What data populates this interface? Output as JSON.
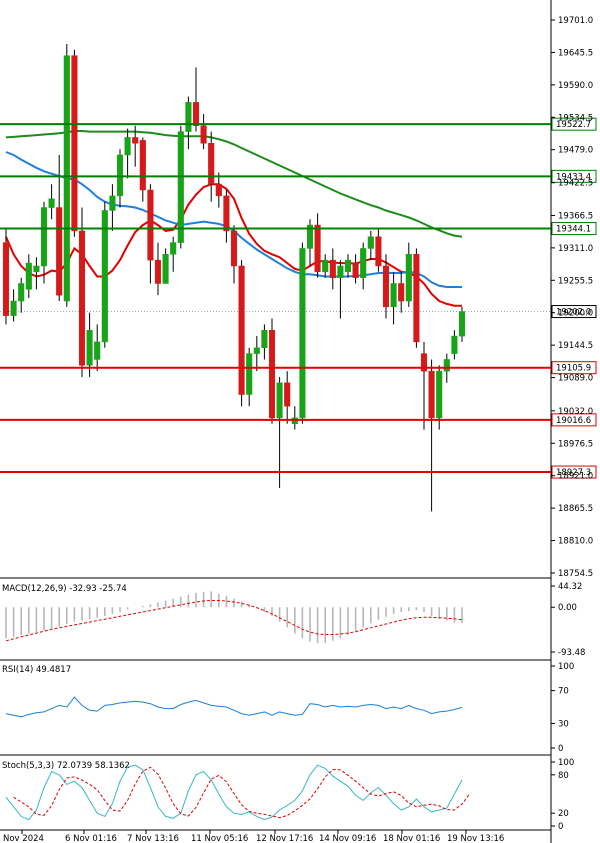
{
  "chart_data": [
    {
      "type": "candlestick",
      "panel": "price",
      "y_ticks": [
        "19701.0",
        "19645.5",
        "19590.0",
        "19534.5",
        "19479.0",
        "19422.5",
        "19366.5",
        "19311.0",
        "19255.5",
        "19200.0",
        "19144.5",
        "19089.0",
        "19032.0",
        "18976.5",
        "18921.0",
        "18865.5",
        "18810.0",
        "18754.5"
      ],
      "y_tick_values": [
        19701.0,
        19645.5,
        19590.0,
        19534.5,
        19479.0,
        19422.5,
        19366.5,
        19311.0,
        19255.5,
        19200.0,
        19144.5,
        19089.0,
        19032.0,
        18976.5,
        18921.0,
        18865.5,
        18810.0,
        18754.5
      ],
      "ylim": [
        18754.5,
        19701.0
      ],
      "current_price": "19202.0",
      "levels": [
        {
          "label": "19522.7",
          "value": 19522.7,
          "color": "#008000"
        },
        {
          "label": "19433.4",
          "value": 19433.4,
          "color": "#008000"
        },
        {
          "label": "19344.1",
          "value": 19344.1,
          "color": "#008000"
        },
        {
          "label": "19105.9",
          "value": 19105.9,
          "color": "#e00000"
        },
        {
          "label": "19016.6",
          "value": 19016.6,
          "color": "#e00000"
        },
        {
          "label": "18927.3",
          "value": 18927.3,
          "color": "#e00000"
        }
      ],
      "x_labels": [
        "Nov 2024",
        "6 Nov 01:16",
        "7 Nov 13:16",
        "11 Nov 05:16",
        "12 Nov 17:16",
        "14 Nov 09:16",
        "18 Nov 01:16",
        "19 Nov 13:16"
      ],
      "candles": [
        {
          "o": 19320,
          "h": 19345,
          "l": 19180,
          "c": 19195
        },
        {
          "o": 19195,
          "h": 19240,
          "l": 19185,
          "c": 19220
        },
        {
          "o": 19220,
          "h": 19260,
          "l": 19200,
          "c": 19250
        },
        {
          "o": 19240,
          "h": 19300,
          "l": 19225,
          "c": 19285
        },
        {
          "o": 19270,
          "h": 19295,
          "l": 19240,
          "c": 19280
        },
        {
          "o": 19280,
          "h": 19390,
          "l": 19250,
          "c": 19380
        },
        {
          "o": 19380,
          "h": 19420,
          "l": 19360,
          "c": 19395
        },
        {
          "o": 19380,
          "h": 19470,
          "l": 19220,
          "c": 19230
        },
        {
          "o": 19220,
          "h": 19660,
          "l": 19210,
          "c": 19640
        },
        {
          "o": 19640,
          "h": 19650,
          "l": 19330,
          "c": 19340
        },
        {
          "o": 19340,
          "h": 19380,
          "l": 19090,
          "c": 19110
        },
        {
          "o": 19110,
          "h": 19200,
          "l": 19090,
          "c": 19170
        },
        {
          "o": 19120,
          "h": 19180,
          "l": 19100,
          "c": 19150
        },
        {
          "o": 19150,
          "h": 19390,
          "l": 19140,
          "c": 19375
        },
        {
          "o": 19375,
          "h": 19420,
          "l": 19340,
          "c": 19400
        },
        {
          "o": 19400,
          "h": 19480,
          "l": 19380,
          "c": 19470
        },
        {
          "o": 19470,
          "h": 19515,
          "l": 19430,
          "c": 19500
        },
        {
          "o": 19500,
          "h": 19520,
          "l": 19450,
          "c": 19490
        },
        {
          "o": 19495,
          "h": 19500,
          "l": 19390,
          "c": 19410
        },
        {
          "o": 19410,
          "h": 19420,
          "l": 19250,
          "c": 19290
        },
        {
          "o": 19290,
          "h": 19320,
          "l": 19230,
          "c": 19250
        },
        {
          "o": 19250,
          "h": 19310,
          "l": 19250,
          "c": 19300
        },
        {
          "o": 19300,
          "h": 19330,
          "l": 19270,
          "c": 19320
        },
        {
          "o": 19320,
          "h": 19520,
          "l": 19310,
          "c": 19510
        },
        {
          "o": 19510,
          "h": 19570,
          "l": 19480,
          "c": 19560
        },
        {
          "o": 19560,
          "h": 19620,
          "l": 19510,
          "c": 19520
        },
        {
          "o": 19520,
          "h": 19540,
          "l": 19480,
          "c": 19490
        },
        {
          "o": 19490,
          "h": 19510,
          "l": 19390,
          "c": 19420
        },
        {
          "o": 19420,
          "h": 19440,
          "l": 19380,
          "c": 19400
        },
        {
          "o": 19400,
          "h": 19410,
          "l": 19320,
          "c": 19340
        },
        {
          "o": 19340,
          "h": 19350,
          "l": 19250,
          "c": 19280
        },
        {
          "o": 19280,
          "h": 19290,
          "l": 19040,
          "c": 19060
        },
        {
          "o": 19060,
          "h": 19140,
          "l": 19040,
          "c": 19130
        },
        {
          "o": 19130,
          "h": 19160,
          "l": 19100,
          "c": 19140
        },
        {
          "o": 19140,
          "h": 19180,
          "l": 19120,
          "c": 19170
        },
        {
          "o": 19170,
          "h": 19190,
          "l": 19010,
          "c": 19020
        },
        {
          "o": 19020,
          "h": 19090,
          "l": 18900,
          "c": 19080
        },
        {
          "o": 19080,
          "h": 19100,
          "l": 19010,
          "c": 19040
        },
        {
          "o": 19010,
          "h": 19040,
          "l": 19000,
          "c": 19020
        },
        {
          "o": 19020,
          "h": 19320,
          "l": 19010,
          "c": 19310
        },
        {
          "o": 19310,
          "h": 19360,
          "l": 19280,
          "c": 19350
        },
        {
          "o": 19350,
          "h": 19370,
          "l": 19260,
          "c": 19270
        },
        {
          "o": 19270,
          "h": 19300,
          "l": 19260,
          "c": 19290
        },
        {
          "o": 19290,
          "h": 19310,
          "l": 19240,
          "c": 19260
        },
        {
          "o": 19260,
          "h": 19290,
          "l": 19190,
          "c": 19280
        },
        {
          "o": 19270,
          "h": 19300,
          "l": 19260,
          "c": 19290
        },
        {
          "o": 19285,
          "h": 19300,
          "l": 19250,
          "c": 19260
        },
        {
          "o": 19260,
          "h": 19320,
          "l": 19240,
          "c": 19310
        },
        {
          "o": 19310,
          "h": 19340,
          "l": 19290,
          "c": 19330
        },
        {
          "o": 19330,
          "h": 19345,
          "l": 19270,
          "c": 19280
        },
        {
          "o": 19280,
          "h": 19300,
          "l": 19190,
          "c": 19210
        },
        {
          "o": 19210,
          "h": 19270,
          "l": 19180,
          "c": 19250
        },
        {
          "o": 19250,
          "h": 19270,
          "l": 19200,
          "c": 19220
        },
        {
          "o": 19220,
          "h": 19320,
          "l": 19210,
          "c": 19300
        },
        {
          "o": 19300,
          "h": 19310,
          "l": 19140,
          "c": 19150
        },
        {
          "o": 19130,
          "h": 19150,
          "l": 19000,
          "c": 19100
        },
        {
          "o": 19100,
          "h": 19120,
          "l": 18860,
          "c": 19020
        },
        {
          "o": 19020,
          "h": 19110,
          "l": 19000,
          "c": 19100
        },
        {
          "o": 19100,
          "h": 19130,
          "l": 19080,
          "c": 19120
        },
        {
          "o": 19130,
          "h": 19170,
          "l": 19120,
          "c": 19160
        },
        {
          "o": 19160,
          "h": 19210,
          "l": 19150,
          "c": 19202
        }
      ],
      "ma_series": [
        {
          "color": "#e00000",
          "values": [
            19330,
            19300,
            19280,
            19268,
            19262,
            19265,
            19272,
            19270,
            19285,
            19310,
            19300,
            19280,
            19262,
            19262,
            19272,
            19290,
            19315,
            19338,
            19350,
            19358,
            19350,
            19340,
            19342,
            19360,
            19385,
            19402,
            19415,
            19420,
            19420,
            19412,
            19395,
            19362,
            19335,
            19318,
            19306,
            19300,
            19295,
            19285,
            19275,
            19272,
            19280,
            19288,
            19288,
            19286,
            19285,
            19285,
            19284,
            19288,
            19292,
            19292,
            19286,
            19278,
            19270,
            19268,
            19262,
            19250,
            19232,
            19220,
            19215,
            19212,
            19212
          ]
        },
        {
          "color": "#1e7fdc",
          "values": [
            19475,
            19470,
            19462,
            19455,
            19448,
            19442,
            19438,
            19434,
            19430,
            19428,
            19420,
            19410,
            19398,
            19390,
            19385,
            19383,
            19382,
            19380,
            19376,
            19370,
            19364,
            19358,
            19354,
            19350,
            19352,
            19354,
            19356,
            19354,
            19352,
            19348,
            19340,
            19328,
            19318,
            19308,
            19300,
            19292,
            19284,
            19276,
            19270,
            19266,
            19266,
            19264,
            19262,
            19262,
            19262,
            19262,
            19263,
            19264,
            19266,
            19268,
            19268,
            19268,
            19268,
            19270,
            19268,
            19262,
            19252,
            19246,
            19244,
            19244,
            19244
          ]
        },
        {
          "color": "#1a8c1a",
          "values": [
            19500,
            19501,
            19502,
            19503,
            19504,
            19505,
            19506,
            19507,
            19509,
            19511,
            19511,
            19510,
            19510,
            19510,
            19510,
            19510,
            19510,
            19510,
            19509,
            19508,
            19506,
            19504,
            19503,
            19502,
            19502,
            19502,
            19502,
            19500,
            19497,
            19493,
            19488,
            19482,
            19476,
            19470,
            19464,
            19458,
            19452,
            19446,
            19440,
            19434,
            19428,
            19422,
            19416,
            19410,
            19404,
            19399,
            19394,
            19389,
            19384,
            19380,
            19375,
            19371,
            19367,
            19363,
            19358,
            19352,
            19346,
            19341,
            19336,
            19332,
            19330
          ]
        }
      ]
    },
    {
      "type": "histogram",
      "panel": "macd",
      "title": "MACD(12,26,9) -32.93 -25.74",
      "y_ticks": [
        "44.32",
        "0.00",
        "-93.48"
      ],
      "y_tick_values": [
        44.32,
        0.0,
        -93.48
      ],
      "ylim": [
        -93.48,
        44.32
      ],
      "histogram": [
        -65,
        -62,
        -58,
        -55,
        -52,
        -48,
        -44,
        -40,
        -35,
        -30,
        -28,
        -25,
        -22,
        -18,
        -14,
        -10,
        -5,
        0,
        3,
        6,
        10,
        14,
        18,
        22,
        26,
        30,
        32,
        33,
        28,
        24,
        18,
        12,
        6,
        -2,
        -10,
        -18,
        -30,
        -42,
        -55,
        -65,
        -72,
        -75,
        -74,
        -70,
        -65,
        -58,
        -50,
        -42,
        -34,
        -26,
        -20,
        -14,
        -10,
        -8,
        -6,
        -10,
        -18,
        -24,
        -28,
        -32,
        -33
      ],
      "signal": [
        -70,
        -66,
        -62,
        -58,
        -54,
        -50,
        -46,
        -43,
        -40,
        -37,
        -34,
        -31,
        -28,
        -25,
        -22,
        -19,
        -16,
        -13,
        -10,
        -7,
        -4,
        -1,
        2,
        5,
        8,
        11,
        13,
        14,
        14,
        13,
        11,
        8,
        4,
        -1,
        -7,
        -14,
        -22,
        -30,
        -38,
        -46,
        -52,
        -56,
        -57,
        -57,
        -56,
        -54,
        -51,
        -47,
        -43,
        -39,
        -35,
        -31,
        -27,
        -24,
        -22,
        -21,
        -21,
        -22,
        -23,
        -24,
        -26
      ]
    },
    {
      "type": "line",
      "panel": "rsi",
      "title": "RSI(14) 49.4817",
      "y_ticks": [
        "100",
        "70",
        "30",
        "0"
      ],
      "y_tick_values": [
        100,
        70,
        30,
        0
      ],
      "ylim": [
        0,
        100
      ],
      "values": [
        42,
        40,
        38,
        41,
        43,
        44,
        48,
        52,
        50,
        62,
        52,
        46,
        45,
        52,
        53,
        55,
        56,
        57,
        56,
        54,
        50,
        48,
        48,
        53,
        56,
        58,
        55,
        52,
        51,
        50,
        46,
        42,
        40,
        42,
        44,
        40,
        44,
        42,
        40,
        41,
        54,
        53,
        50,
        52,
        50,
        51,
        50,
        52,
        53,
        52,
        48,
        50,
        48,
        52,
        48,
        46,
        42,
        44,
        45,
        47,
        49.5
      ]
    },
    {
      "type": "line",
      "panel": "stoch",
      "title": "Stoch(5,3,3) 72.0739 58.1362",
      "y_ticks": [
        "100",
        "80",
        "20",
        "0"
      ],
      "y_tick_values": [
        100,
        80,
        20,
        0
      ],
      "ylim": [
        0,
        100
      ],
      "k": [
        45,
        30,
        15,
        10,
        25,
        60,
        85,
        80,
        65,
        70,
        60,
        40,
        20,
        15,
        35,
        70,
        92,
        95,
        88,
        60,
        30,
        15,
        12,
        20,
        55,
        80,
        85,
        72,
        50,
        30,
        20,
        18,
        22,
        15,
        10,
        14,
        25,
        32,
        40,
        55,
        80,
        95,
        90,
        78,
        70,
        62,
        48,
        40,
        52,
        60,
        48,
        35,
        25,
        30,
        42,
        30,
        22,
        25,
        28,
        50,
        72
      ]
    }
  ]
}
